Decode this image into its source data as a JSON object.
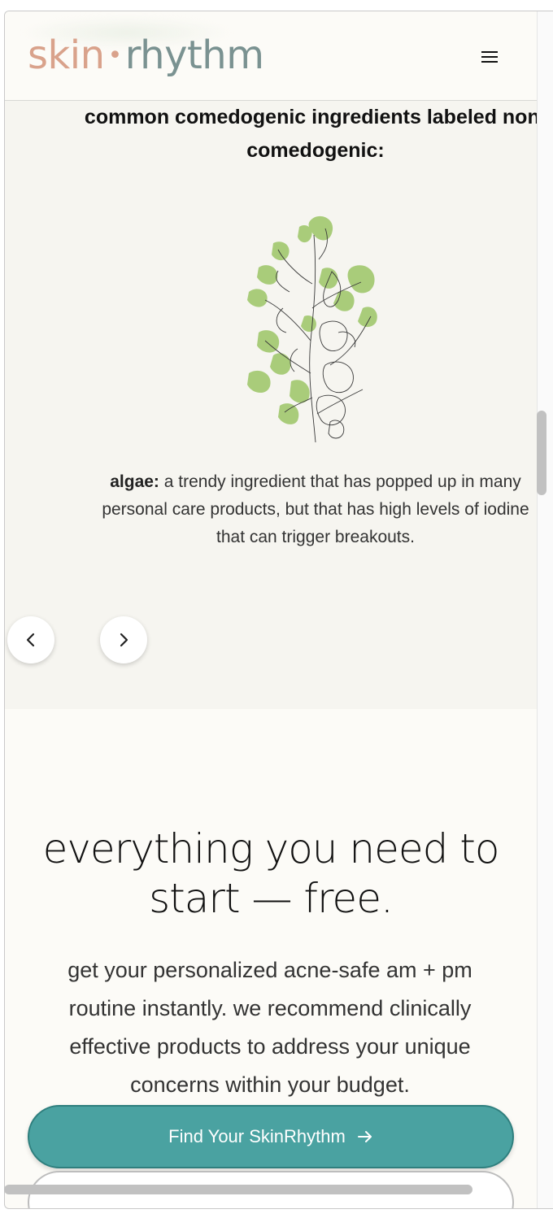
{
  "header": {
    "logo_skin": "skin",
    "logo_dot": "•",
    "logo_rhythm": "rhythm",
    "menu_icon": "hamburger-menu-icon"
  },
  "carousel": {
    "heading_line1": "common comedogenic ingredients labeled non-",
    "heading_line2": "comedogenic:",
    "image_icon": "algae-plant-illustration",
    "text_term": "algae:",
    "text_line1": " a trendy ingredient that has popped up in many",
    "text_line2": "personal care products, but that has high levels of iodine",
    "text_line3": "that can trigger breakouts.",
    "prev_icon": "chevron-left-icon",
    "next_icon": "chevron-right-icon"
  },
  "free_section": {
    "title_line1": "everything you need to",
    "title_line2": "start — free.",
    "body_line1": "get your personalized acne-safe am + pm",
    "body_line2": "routine instantly. we recommend clinically",
    "body_line3": "effective products to address your unique",
    "body_line4": "concerns within your budget.",
    "cta_label": "Find Your SkinRhythm",
    "cta_icon": "arrow-right-icon"
  },
  "colors": {
    "accent_teal": "#4aa2a1",
    "logo_skin": "#d9a28b",
    "logo_rhythm": "#7a9291",
    "plant_green": "#a9cc7a"
  }
}
